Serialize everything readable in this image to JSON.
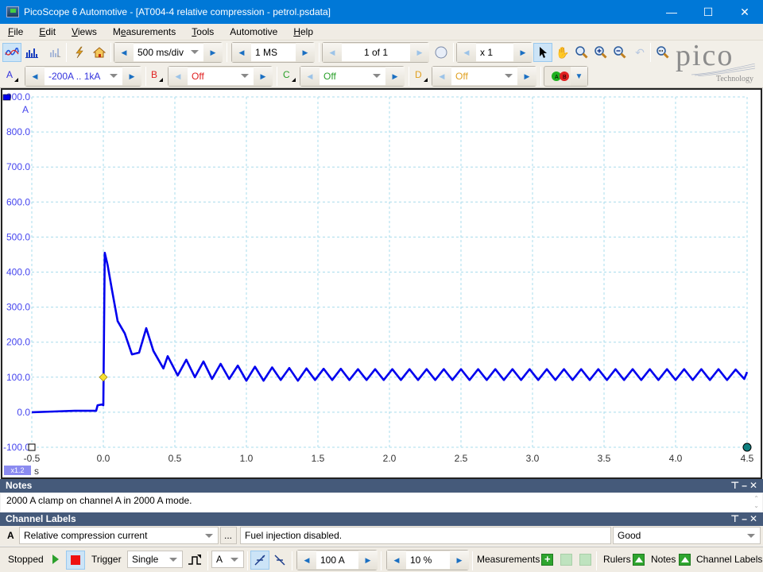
{
  "window": {
    "title": "PicoScope 6 Automotive - [AT004-4 relative compression - petrol.psdata]",
    "controls": [
      "minimize",
      "maximize",
      "close"
    ]
  },
  "menu": [
    "File",
    "Edit",
    "Views",
    "Measurements",
    "Tools",
    "Automotive",
    "Help"
  ],
  "toolbar": {
    "timebase": "500 ms/div",
    "samples": "1 MS",
    "buffer": "1 of 1",
    "zoom_factor": "x 1",
    "logo_text": "pico",
    "logo_sub": "Technology"
  },
  "channels": [
    {
      "id": "A",
      "range": "-200A .. 1kA",
      "color": "#3333dd"
    },
    {
      "id": "B",
      "range": "Off",
      "color": "#e02020"
    },
    {
      "id": "C",
      "range": "Off",
      "color": "#2aa02a"
    },
    {
      "id": "D",
      "range": "Off",
      "color": "#e0a020"
    }
  ],
  "scope": {
    "trace_color": "#0000ee",
    "axis_unit_y": "A",
    "axis_unit_x": "s",
    "x_zoom_badge": "x1.2"
  },
  "chart_data": {
    "type": "line",
    "title": "",
    "xlabel": "s",
    "ylabel": "A",
    "xlim": [
      -0.5,
      4.5
    ],
    "ylim": [
      -100,
      900
    ],
    "x_ticks": [
      "-0.5",
      "0.0",
      "0.5",
      "1.0",
      "1.5",
      "2.0",
      "2.5",
      "3.0",
      "3.5",
      "4.0",
      "4.5"
    ],
    "y_ticks": [
      "900.0",
      "800.0",
      "700.0",
      "600.0",
      "500.0",
      "400.0",
      "300.0",
      "200.0",
      "100.0",
      "0.0",
      "-100.0"
    ],
    "grid": true,
    "trigger_marker": {
      "x": 0.0,
      "y": 100
    },
    "series": [
      {
        "name": "A",
        "description": "Relative compression current",
        "points": [
          [
            -0.5,
            0
          ],
          [
            -0.35,
            2
          ],
          [
            -0.2,
            4
          ],
          [
            -0.05,
            4
          ],
          [
            -0.04,
            20
          ],
          [
            -0.01,
            22
          ],
          [
            0.0,
            20
          ],
          [
            0.01,
            455
          ],
          [
            0.03,
            420
          ],
          [
            0.06,
            350
          ],
          [
            0.1,
            260
          ],
          [
            0.15,
            225
          ],
          [
            0.2,
            165
          ],
          [
            0.25,
            170
          ],
          [
            0.3,
            240
          ],
          [
            0.35,
            175
          ],
          [
            0.42,
            125
          ],
          [
            0.45,
            160
          ],
          [
            0.52,
            105
          ],
          [
            0.58,
            150
          ],
          [
            0.64,
            100
          ],
          [
            0.7,
            145
          ],
          [
            0.76,
            95
          ],
          [
            0.82,
            138
          ],
          [
            0.88,
            95
          ],
          [
            0.94,
            133
          ],
          [
            1.0,
            90
          ],
          [
            1.06,
            130
          ],
          [
            1.12,
            90
          ],
          [
            1.18,
            128
          ],
          [
            1.24,
            92
          ],
          [
            1.3,
            126
          ],
          [
            1.36,
            90
          ],
          [
            1.42,
            125
          ],
          [
            1.48,
            92
          ],
          [
            1.54,
            124
          ],
          [
            1.6,
            92
          ],
          [
            1.66,
            124
          ],
          [
            1.72,
            92
          ],
          [
            1.78,
            123
          ],
          [
            1.84,
            92
          ],
          [
            1.9,
            123
          ],
          [
            1.96,
            92
          ],
          [
            2.02,
            123
          ],
          [
            2.08,
            92
          ],
          [
            2.14,
            123
          ],
          [
            2.2,
            92
          ],
          [
            2.26,
            123
          ],
          [
            2.32,
            92
          ],
          [
            2.38,
            123
          ],
          [
            2.44,
            92
          ],
          [
            2.5,
            123
          ],
          [
            2.56,
            92
          ],
          [
            2.62,
            123
          ],
          [
            2.68,
            92
          ],
          [
            2.74,
            123
          ],
          [
            2.8,
            92
          ],
          [
            2.86,
            123
          ],
          [
            2.92,
            92
          ],
          [
            2.98,
            123
          ],
          [
            3.04,
            92
          ],
          [
            3.1,
            123
          ],
          [
            3.16,
            92
          ],
          [
            3.22,
            123
          ],
          [
            3.28,
            92
          ],
          [
            3.34,
            123
          ],
          [
            3.4,
            92
          ],
          [
            3.46,
            123
          ],
          [
            3.52,
            92
          ],
          [
            3.58,
            123
          ],
          [
            3.64,
            92
          ],
          [
            3.7,
            123
          ],
          [
            3.76,
            92
          ],
          [
            3.82,
            123
          ],
          [
            3.88,
            92
          ],
          [
            3.94,
            123
          ],
          [
            4.0,
            92
          ],
          [
            4.06,
            123
          ],
          [
            4.12,
            92
          ],
          [
            4.18,
            123
          ],
          [
            4.24,
            92
          ],
          [
            4.3,
            123
          ],
          [
            4.36,
            92
          ],
          [
            4.42,
            122
          ],
          [
            4.48,
            95
          ],
          [
            4.5,
            115
          ]
        ]
      }
    ]
  },
  "notes_panel": {
    "title": "Notes",
    "text": "2000 A clamp on channel A in 2000 A mode."
  },
  "channel_labels_panel": {
    "title": "Channel Labels",
    "channel": "A",
    "label": "Relative compression current",
    "ellipsis": "...",
    "description": "Fuel injection disabled.",
    "rating": "Good"
  },
  "statusbar": {
    "state": "Stopped",
    "trigger_label": "Trigger",
    "trigger_mode": "Single",
    "trigger_channel": "A",
    "threshold": "100 A",
    "pre_trigger": "10 %",
    "measurements_label": "Measurements",
    "rulers_label": "Rulers",
    "notes_label": "Notes",
    "channel_labels_label": "Channel Labels"
  }
}
